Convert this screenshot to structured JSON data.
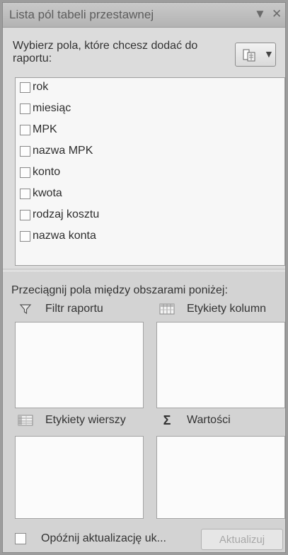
{
  "panel": {
    "title": "Lista pól tabeli przestawnej",
    "dropdown_glyph": "▼",
    "close_glyph": "✕"
  },
  "field_section": {
    "instruction": "Wybierz pola, które chcesz dodać do raportu:",
    "layout_button_icon": "field-list-layout-icon",
    "fields": [
      {
        "label": "rok",
        "checked": false
      },
      {
        "label": "miesiąc",
        "checked": false
      },
      {
        "label": "MPK",
        "checked": false
      },
      {
        "label": "nazwa MPK",
        "checked": false
      },
      {
        "label": "konto",
        "checked": false
      },
      {
        "label": "kwota",
        "checked": false
      },
      {
        "label": "rodzaj kosztu",
        "checked": false
      },
      {
        "label": "nazwa konta",
        "checked": false
      }
    ]
  },
  "areas_section": {
    "instruction": "Przeciągnij pola między obszarami poniżej:",
    "report_filter": {
      "label": "Filtr raportu",
      "icon": "filter-funnel-icon"
    },
    "column_labels": {
      "label": "Etykiety kolumn",
      "icon": "column-grid-icon"
    },
    "row_labels": {
      "label": "Etykiety wierszy",
      "icon": "row-grid-icon"
    },
    "values": {
      "label": "Wartości",
      "icon": "sigma-icon",
      "glyph": "Σ"
    }
  },
  "footer": {
    "defer_label": "Opóźnij aktualizację uk...",
    "defer_checked": false,
    "update_label": "Aktualizuj",
    "update_enabled": false
  }
}
